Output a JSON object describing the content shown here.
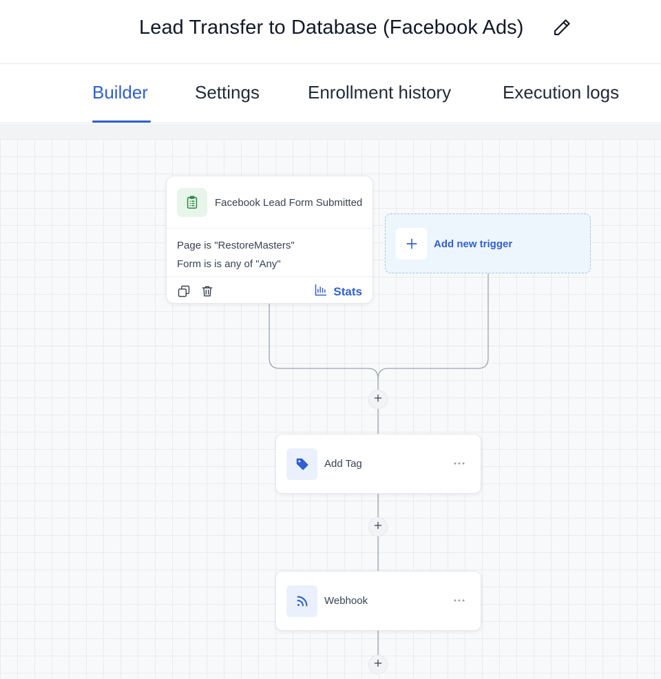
{
  "header": {
    "title": "Lead Transfer to Database (Facebook Ads)"
  },
  "tabs": [
    {
      "label": "Builder",
      "active": true
    },
    {
      "label": "Settings",
      "active": false
    },
    {
      "label": "Enrollment history",
      "active": false
    },
    {
      "label": "Execution logs",
      "active": false
    }
  ],
  "trigger": {
    "title": "Facebook Lead Form Submitted",
    "conditions": [
      "Page is \"RestoreMasters\"",
      "Form is is any of \"Any\""
    ],
    "stats_label": "Stats",
    "icon": "clipboard-icon"
  },
  "add_trigger": {
    "label": "Add new trigger"
  },
  "actions": [
    {
      "label": "Add Tag",
      "icon": "tag-icon"
    },
    {
      "label": "Webhook",
      "icon": "rss-icon"
    }
  ],
  "colors": {
    "accent": "#2f5fd0",
    "trigger_icon_bg": "#e7f5ea",
    "trigger_icon": "#2e8a47",
    "add_trigger_bg": "#eef6fd"
  }
}
